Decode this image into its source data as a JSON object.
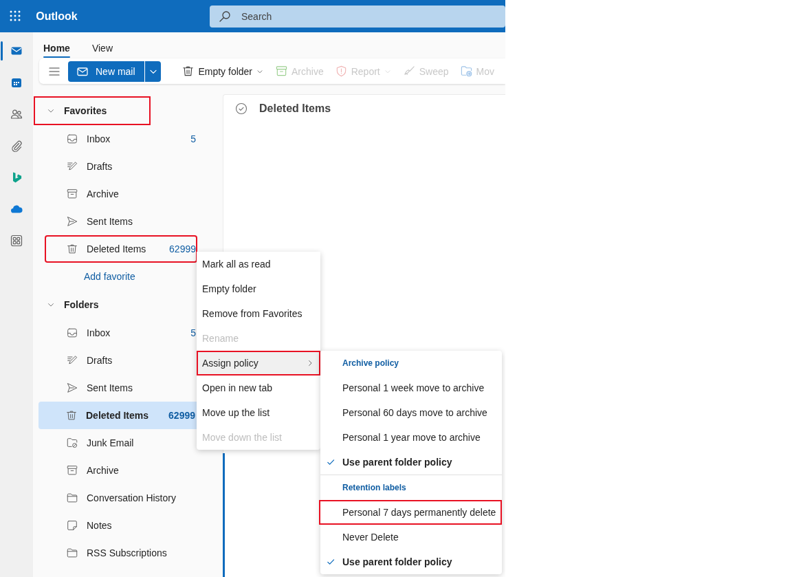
{
  "app": {
    "name": "Outlook"
  },
  "search": {
    "placeholder": "Search"
  },
  "rail": [
    {
      "kind": "mail",
      "selected": true
    },
    {
      "kind": "calendar",
      "selected": false
    },
    {
      "kind": "people",
      "selected": false
    },
    {
      "kind": "attach",
      "selected": false
    },
    {
      "kind": "bing",
      "selected": false
    },
    {
      "kind": "onedrive",
      "selected": false
    },
    {
      "kind": "apps",
      "selected": false
    }
  ],
  "tabs": [
    {
      "label": "Home",
      "selected": true
    },
    {
      "label": "View",
      "selected": false
    }
  ],
  "toolbar": {
    "new_mail": "New mail",
    "actions": [
      {
        "label": "Empty folder",
        "kind": "trash",
        "disabled": false,
        "dropdown": true
      },
      {
        "label": "Archive",
        "kind": "archive",
        "disabled": true,
        "dropdown": false
      },
      {
        "label": "Report",
        "kind": "shield",
        "disabled": true,
        "dropdown": true
      },
      {
        "label": "Sweep",
        "kind": "broom",
        "disabled": true,
        "dropdown": false
      },
      {
        "label": "Mov",
        "kind": "move",
        "disabled": true,
        "dropdown": false
      }
    ]
  },
  "sections": [
    {
      "title": "Favorites",
      "expanded": true,
      "highlighted": true,
      "items": [
        {
          "label": "Inbox",
          "kind": "inbox",
          "count": "5",
          "selected": false,
          "highlighted": false
        },
        {
          "label": "Drafts",
          "kind": "drafts",
          "selected": false,
          "highlighted": false
        },
        {
          "label": "Archive",
          "kind": "archive",
          "selected": false,
          "highlighted": false
        },
        {
          "label": "Sent Items",
          "kind": "sent",
          "selected": false,
          "highlighted": false
        },
        {
          "label": "Deleted Items",
          "kind": "trash",
          "count": "62999",
          "selected": false,
          "highlighted": true
        }
      ],
      "link": "Add favorite"
    },
    {
      "title": "Folders",
      "expanded": true,
      "highlighted": false,
      "items": [
        {
          "label": "Inbox",
          "kind": "inbox",
          "count": "5",
          "selected": false,
          "highlighted": false
        },
        {
          "label": "Drafts",
          "kind": "drafts",
          "selected": false,
          "highlighted": false
        },
        {
          "label": "Sent Items",
          "kind": "sent",
          "selected": false,
          "highlighted": false
        },
        {
          "label": "Deleted Items",
          "kind": "trash",
          "count": "62999",
          "selected": true,
          "highlighted": false
        },
        {
          "label": "Junk Email",
          "kind": "junk",
          "selected": false,
          "highlighted": false
        },
        {
          "label": "Archive",
          "kind": "archive",
          "selected": false,
          "highlighted": false
        },
        {
          "label": "Conversation History",
          "kind": "folder",
          "selected": false,
          "highlighted": false
        },
        {
          "label": "Notes",
          "kind": "note",
          "selected": false,
          "highlighted": false
        },
        {
          "label": "RSS Subscriptions",
          "kind": "folder",
          "selected": false,
          "highlighted": false
        }
      ]
    }
  ],
  "message_list": {
    "title": "Deleted Items"
  },
  "context_menu": {
    "items": [
      {
        "label": "Mark all as read",
        "disabled": false,
        "submenu": false,
        "selected": false,
        "highlighted": false
      },
      {
        "label": "Empty folder",
        "disabled": false,
        "submenu": false,
        "selected": false,
        "highlighted": false
      },
      {
        "label": "Remove from Favorites",
        "disabled": false,
        "submenu": false,
        "selected": false,
        "highlighted": false
      },
      {
        "label": "Rename",
        "disabled": true,
        "submenu": false,
        "selected": false,
        "highlighted": false
      },
      {
        "label": "Assign policy",
        "disabled": false,
        "submenu": true,
        "selected": true,
        "highlighted": true
      },
      {
        "label": "Open in new tab",
        "disabled": false,
        "submenu": false,
        "selected": false,
        "highlighted": false
      },
      {
        "label": "Move up the list",
        "disabled": false,
        "submenu": false,
        "selected": false,
        "highlighted": false
      },
      {
        "label": "Move down the list",
        "disabled": true,
        "submenu": false,
        "selected": false,
        "highlighted": false
      }
    ]
  },
  "submenu": {
    "groups": [
      {
        "heading": "Archive policy",
        "items": [
          {
            "label": "Personal 1 week move to archive",
            "checked": false,
            "highlighted": false
          },
          {
            "label": "Personal 60 days move to archive",
            "checked": false,
            "highlighted": false
          },
          {
            "label": "Personal 1 year move to archive",
            "checked": false,
            "highlighted": false
          },
          {
            "label": "Use parent folder policy",
            "checked": true,
            "highlighted": false
          }
        ]
      },
      {
        "heading": "Retention labels",
        "items": [
          {
            "label": "Personal 7 days permanently delete",
            "checked": false,
            "highlighted": true
          },
          {
            "label": "Never Delete",
            "checked": false,
            "highlighted": false
          },
          {
            "label": "Use parent folder policy",
            "checked": true,
            "highlighted": false
          }
        ]
      }
    ]
  }
}
